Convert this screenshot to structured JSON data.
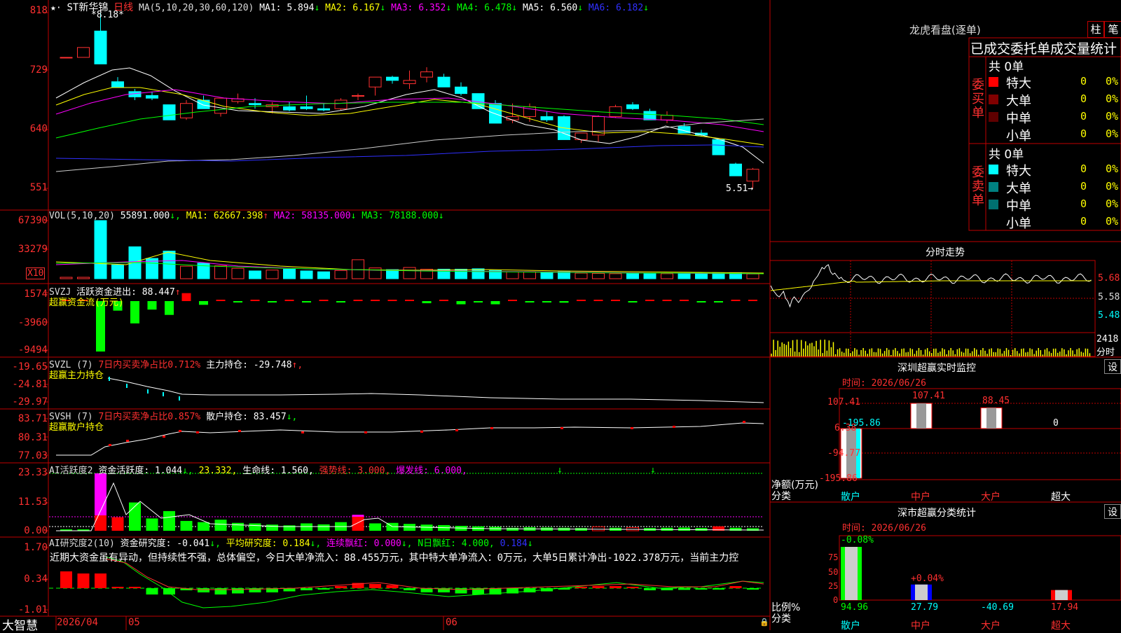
{
  "stock": {
    "name": "ST新华锦",
    "period": "日线",
    "ma_header": {
      "label": "MA(5,10,20,30,60,120)",
      "items": [
        {
          "name": "MA1:",
          "value": "5.894",
          "arrow": "↓",
          "color": "#ffffff"
        },
        {
          "name": "MA2:",
          "value": "6.167",
          "arrow": "↓",
          "color": "#ffff00"
        },
        {
          "name": "MA3:",
          "value": "6.352",
          "arrow": "↓",
          "color": "#ff00ff"
        },
        {
          "name": "MA4:",
          "value": "6.478",
          "arrow": "↓",
          "color": "#00ff00"
        },
        {
          "name": "MA5:",
          "value": "6.560",
          "arrow": "↓",
          "color": "#ffffff"
        },
        {
          "name": "MA6:",
          "value": "6.182",
          "arrow": "↓",
          "color": "#3030ff"
        }
      ]
    },
    "high_mark": "8.18",
    "low_mark": "5.51→",
    "price_ticks": [
      "818",
      "729",
      "640",
      "551"
    ]
  },
  "vol_panel": {
    "header": "VOL(5,10,20)",
    "value": "55891.000",
    "items": [
      {
        "name": "MA1:",
        "value": "62667.398",
        "arrow": "↑",
        "color": "#ffff00"
      },
      {
        "name": "MA2:",
        "value": "58135.000",
        "arrow": "↓",
        "color": "#ff00ff"
      },
      {
        "name": "MA3:",
        "value": "78188.000",
        "arrow": "↓",
        "color": "#00ff00"
      }
    ],
    "ticks": [
      "67390",
      "33279"
    ],
    "unit_box": "X10"
  },
  "svzj_panel": {
    "header": "SVZJ",
    "label": "活跃资金进出:",
    "value": "88.447",
    "arrow": "↑",
    "sub": "超赢资金流(万元)",
    "ticks": [
      "1574",
      "-3960",
      "-9494"
    ]
  },
  "svzl_panel": {
    "header": "SVZL (7)",
    "label": "7日内买卖净占比0.712%",
    "label2": "主力持仓:",
    "value": "-29.748",
    "arrow": "↑,",
    "sub": "超赢主力持仓",
    "ticks": [
      "-19.65",
      "-24.81",
      "-29.97"
    ]
  },
  "svsh_panel": {
    "header": "SVSH (7)",
    "label": "7日内买卖净占比0.857%",
    "label2": "散户持仓:",
    "value": "83.457",
    "arrow": "↓,",
    "sub": "超赢散户持仓",
    "ticks": [
      "83.71",
      "80.31",
      "77.03"
    ]
  },
  "ai_active": {
    "header": "AI活跃度2",
    "label": "资金活跃度:",
    "value": "1.044",
    "arrow": "↓,",
    "v2": "23.332,",
    "life_label": "生命线:",
    "life_value": "1.560,",
    "strong_label": "强势线:",
    "strong_value": "3.000,",
    "burst_label": "爆发线:",
    "burst_value": "6.000,",
    "ticks": [
      "23.33",
      "11.53",
      "0.00"
    ]
  },
  "ai_research": {
    "header": "AI研究度2(10)",
    "label": "资金研究度:",
    "value": "-0.041",
    "arrow": "↓,",
    "avg_label": "平均研究度:",
    "avg_value": "0.184",
    "avg_arrow": "↓,",
    "red_label": "连续飘红:",
    "red_value": "0.000",
    "red_arrow": "↓,",
    "nred_label": "N日飘红:",
    "nred_value": "4.000,",
    "blue_value": "0.184",
    "blue_arrow": "↓",
    "commentary": "近期大资金虽有异动，但持续性不强，总体偏空，今日大单净流入：88.455万元，其中特大单净流入：0万元，大单5日累计净出-1022.378万元，当前主力控",
    "ticks": [
      "1.70",
      "0.34",
      "-1.01"
    ]
  },
  "footer": {
    "brand": "大智慧",
    "date_label": "2026/04",
    "month_may": "05",
    "month_jun": "06"
  },
  "right": {
    "lhb_title": "龙虎看盘(逐单)",
    "tab_zhu": "柱",
    "tab_bi": "笔",
    "stats_header": "已成交委托单成交量统计",
    "buy_side": {
      "label": "委买单",
      "count": "共 0单",
      "rows": [
        {
          "label": "特大",
          "value": "0",
          "pct": "0%",
          "color": "#ff0000"
        },
        {
          "label": "大单",
          "value": "0",
          "pct": "0%",
          "color": "#800000"
        },
        {
          "label": "中单",
          "value": "0",
          "pct": "0%",
          "color": "#600000"
        },
        {
          "label": "小单",
          "value": "0",
          "pct": "0%",
          "color": "#000000"
        }
      ]
    },
    "sell_side": {
      "label": "委卖单",
      "count": "共 0单",
      "rows": [
        {
          "label": "特大",
          "value": "0",
          "pct": "0%",
          "color": "#00ffff"
        },
        {
          "label": "大单",
          "value": "0",
          "pct": "0%",
          "color": "#008080"
        },
        {
          "label": "中单",
          "value": "0",
          "pct": "0%",
          "color": "#007070"
        },
        {
          "label": "小单",
          "value": "0",
          "pct": "0%",
          "color": "#000000"
        }
      ]
    },
    "intraday": {
      "title": "分时走势",
      "price_ticks": [
        "5.68",
        "5.58",
        "5.48"
      ],
      "vol_tick": "2418",
      "vol_unit": "分时"
    },
    "sz_monitor": {
      "title": "深圳超赢实时监控",
      "settings": "设",
      "time": "时间: 2026/06/26",
      "ticks": [
        "107.41",
        "6.38",
        "-94.77",
        "-195.86"
      ],
      "unit": "净额(万元)",
      "cat_label": "分类",
      "categories": [
        "散户",
        "中户",
        "大户",
        "超大"
      ],
      "values": [
        -195.86,
        107.41,
        88.45,
        0
      ],
      "labels": [
        "-195.86",
        "107.41",
        "88.45",
        "0"
      ]
    },
    "sz_classify": {
      "title": "深市超赢分类统计",
      "settings": "设",
      "time": "时间: 2026/06/26",
      "ticks": [
        "75",
        "50",
        "25",
        "0"
      ],
      "unit": "比例%",
      "cat_label": "分类",
      "categories": [
        "散户",
        "中户",
        "大户",
        "超大"
      ],
      "top_labels": [
        "-0.08%",
        "+0.04%",
        "",
        ""
      ],
      "values": [
        "94.96",
        "27.79",
        "-40.69",
        "17.94"
      ]
    }
  },
  "colors": {
    "up": "#ff3030",
    "down": "#00ffff",
    "grid": "#c00000",
    "green": "#00ff00",
    "yellow": "#ffff00",
    "magenta": "#ff00ff",
    "blue": "#3030ff"
  }
}
